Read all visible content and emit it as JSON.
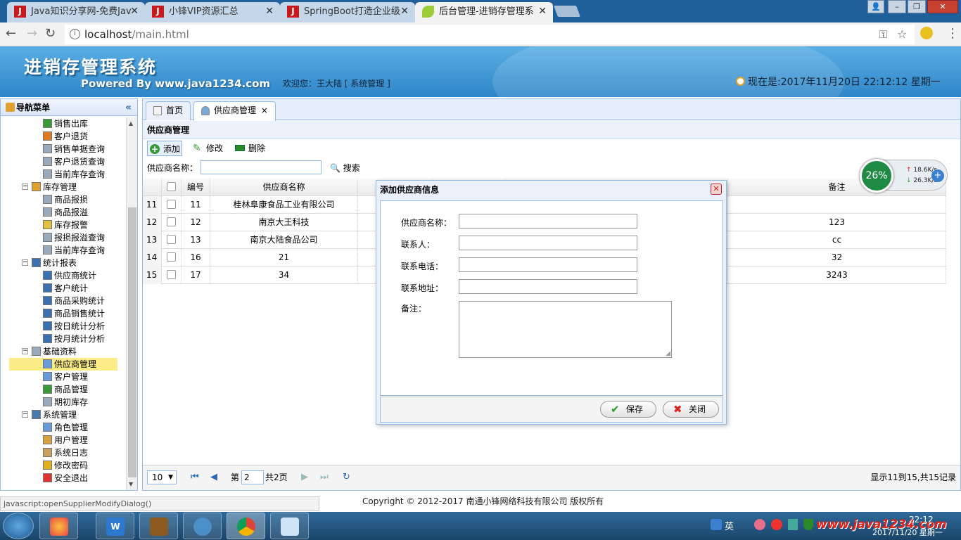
{
  "browser": {
    "tabs": [
      {
        "label": "Java知识分享网-免费Jav",
        "icon": "J"
      },
      {
        "label": "小锋VIP资源汇总",
        "icon": "J"
      },
      {
        "label": "SpringBoot打造企业级",
        "icon": "J"
      },
      {
        "label": "后台管理-进销存管理系",
        "icon": "leaf-icon"
      }
    ],
    "url_host": "localhost",
    "url_path": "/main.html"
  },
  "header": {
    "title": "进销存管理系统",
    "powered": "Powered By www.java1234.com",
    "welcome": "欢迎您：王大陆 [ 系统管理 ]",
    "clock": "现在是:2017年11月20日 22:12:12 星期一"
  },
  "nav": {
    "title": "导航菜单",
    "items": [
      {
        "label": "销售出库",
        "icon": "outbound-icon"
      },
      {
        "label": "客户退货",
        "icon": "return-icon"
      },
      {
        "label": "销售单据查询",
        "icon": "search-doc-icon"
      },
      {
        "label": "客户退货查询",
        "icon": "search-doc-icon"
      },
      {
        "label": "当前库存查询",
        "icon": "search-doc-icon"
      },
      {
        "label": "库存管理",
        "icon": "folder-icon"
      },
      {
        "label": "商品报损",
        "icon": "search-doc-icon"
      },
      {
        "label": "商品报溢",
        "icon": "search-doc-icon"
      },
      {
        "label": "库存报警",
        "icon": "alarm-icon"
      },
      {
        "label": "报损报溢查询",
        "icon": "search-doc-icon"
      },
      {
        "label": "当前库存查询",
        "icon": "search-doc-icon"
      },
      {
        "label": "统计报表",
        "icon": "chart-icon"
      },
      {
        "label": "供应商统计",
        "icon": "chart-icon"
      },
      {
        "label": "客户统计",
        "icon": "chart-icon"
      },
      {
        "label": "商品采购统计",
        "icon": "chart-icon"
      },
      {
        "label": "商品销售统计",
        "icon": "chart-icon"
      },
      {
        "label": "按日统计分析",
        "icon": "chart-icon"
      },
      {
        "label": "按月统计分析",
        "icon": "chart-icon"
      },
      {
        "label": "基础资料",
        "icon": "doc-icon"
      },
      {
        "label": "供应商管理",
        "icon": "user-icon"
      },
      {
        "label": "客户管理",
        "icon": "user-icon"
      },
      {
        "label": "商品管理",
        "icon": "tree-icon"
      },
      {
        "label": "期初库存",
        "icon": "doc-icon"
      },
      {
        "label": "系统管理",
        "icon": "computer-icon"
      },
      {
        "label": "角色管理",
        "icon": "user-icon"
      },
      {
        "label": "用户管理",
        "icon": "users-icon"
      },
      {
        "label": "系统日志",
        "icon": "log-icon"
      },
      {
        "label": "修改密码",
        "icon": "key-icon"
      },
      {
        "label": "安全退出",
        "icon": "exit-icon"
      }
    ]
  },
  "main": {
    "tabs": [
      {
        "label": "首页"
      },
      {
        "label": "供应商管理",
        "close": "×"
      }
    ],
    "panel_title": "供应商管理",
    "toolbar": {
      "add": "添加",
      "edit": "修改",
      "delete": "删除"
    },
    "search": {
      "label": "供应商名称：",
      "button": "搜索",
      "value": ""
    },
    "grid": {
      "headers": {
        "num": "编号",
        "name": "供应商名称",
        "remark": "备注"
      },
      "rows": [
        {
          "row": "11",
          "num": "11",
          "name": "桂林阜康食品工业有限公司",
          "remark": ""
        },
        {
          "row": "12",
          "num": "12",
          "name": "南京大王科技",
          "remark": "123"
        },
        {
          "row": "13",
          "num": "13",
          "name": "南京大陆食品公司",
          "remark": "cc"
        },
        {
          "row": "14",
          "num": "16",
          "name": "21",
          "remark": "32"
        },
        {
          "row": "15",
          "num": "17",
          "name": "34",
          "remark": "3243"
        }
      ]
    },
    "pager": {
      "page_size": "10",
      "page_prefix": "第",
      "page": "2",
      "page_total": "共2页",
      "summary": "显示11到15,共15记录"
    }
  },
  "dialog": {
    "title": "添加供应商信息",
    "fields": {
      "name": "供应商名称：",
      "contact": "联系人：",
      "phone": "联系电话：",
      "address": "联系地址：",
      "remark": "备注："
    },
    "save": "保存",
    "close": "关闭"
  },
  "status_url": "javascript:openSupplierModifyDialog()",
  "copyright": "Copyright © 2012-2017 南通小锋网络科技有限公司 版权所有",
  "net_widget": {
    "percent": "26%",
    "up": "18.6K/s",
    "down": "26.3K/s"
  },
  "tray": {
    "ime": "英",
    "time": "22:12",
    "date": "2017/11/20 星期一",
    "watermark": "www.java1234.com"
  },
  "colors": {
    "accent": "#95b8e7",
    "header": "#3d93d6",
    "selected": "#fbec88"
  }
}
